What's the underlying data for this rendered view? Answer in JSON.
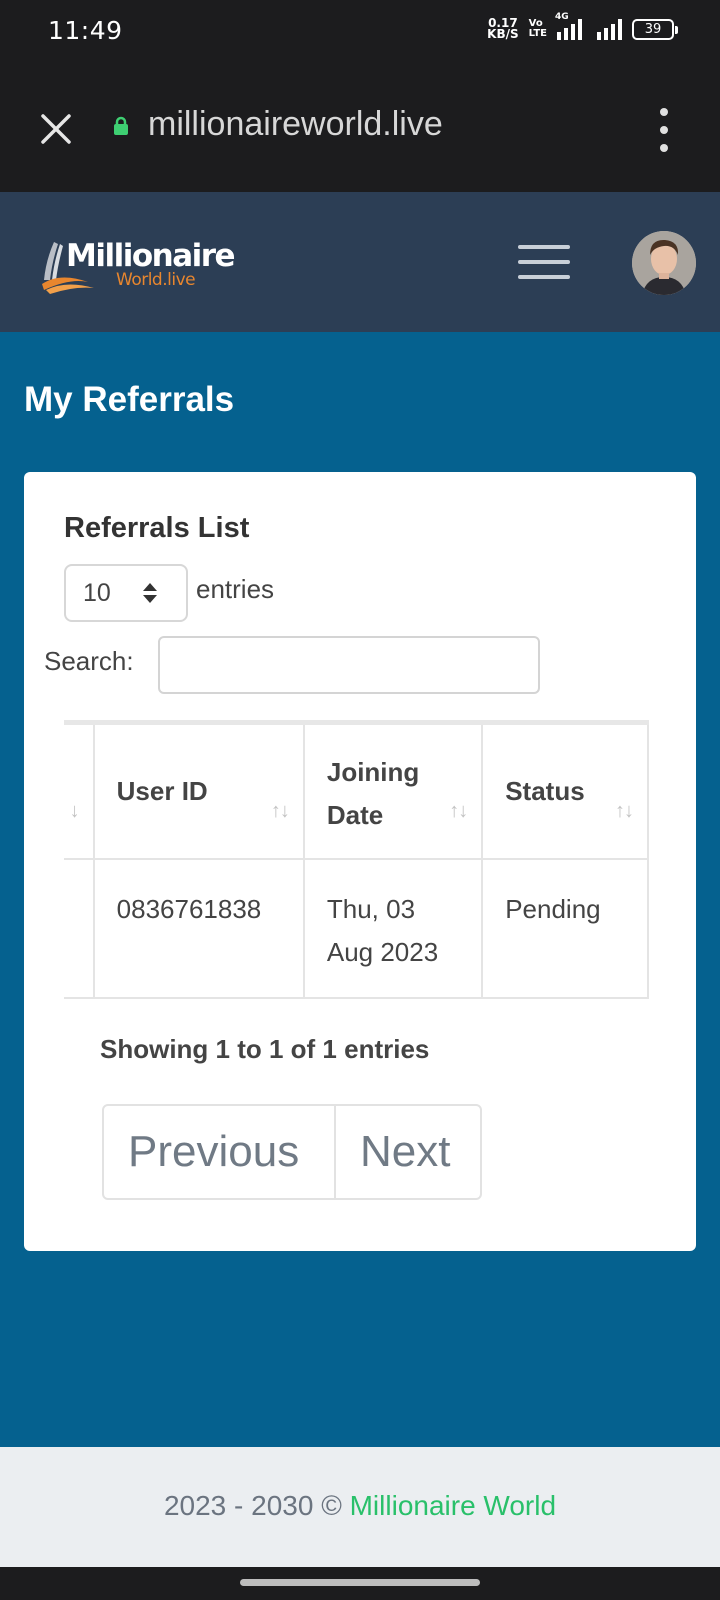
{
  "status_bar": {
    "time": "11:49",
    "net_speed_value": "0.17",
    "net_speed_unit": "KB/S",
    "volte_top": "Vo",
    "volte_bottom": "LTE",
    "network_type": "4G",
    "battery": "39"
  },
  "browser": {
    "url": "millionaireworld.live",
    "icons": [
      "close-icon",
      "lock-icon",
      "more-vert-icon"
    ]
  },
  "header": {
    "logo_main": "Millionaire",
    "logo_sub": "World.live",
    "icons": [
      "menu-icon",
      "avatar"
    ]
  },
  "page": {
    "title": "My Referrals"
  },
  "referrals": {
    "card_title": "Referrals List",
    "entries_value": "10",
    "entries_label": "entries",
    "search_label": "Search:",
    "search_value": "",
    "columns": [
      "",
      "User ID",
      "Joining Date",
      "Status"
    ],
    "rows": [
      {
        "col0": "",
        "user_id": "0836761838",
        "joining_date": "Thu, 03 Aug 2023",
        "status": "Pending"
      }
    ],
    "showing": "Showing 1 to 1 of 1 entries",
    "prev_label": "Previous",
    "next_label": "Next"
  },
  "footer": {
    "years": "2023 - 2030 ©",
    "brand": "Millionaire World"
  },
  "colors": {
    "header_bg": "#2c3e55",
    "main_bg": "#05618f",
    "footer_link": "#29c06a",
    "logo_accent": "#e8862e"
  }
}
